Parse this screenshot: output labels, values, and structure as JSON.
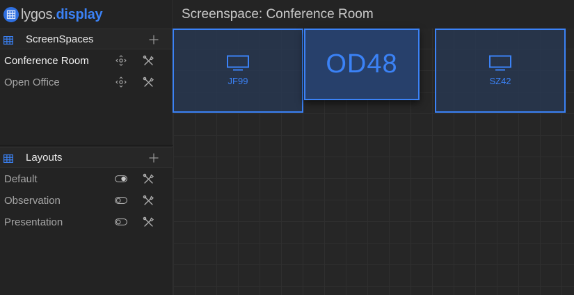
{
  "brand": {
    "name_part1": "lygos.",
    "name_part2": "display"
  },
  "sidebar": {
    "screenspaces": {
      "title": "ScreenSpaces",
      "items": [
        {
          "label": "Conference Room"
        },
        {
          "label": "Open Office"
        }
      ]
    },
    "layouts": {
      "title": "Layouts",
      "items": [
        {
          "label": "Default",
          "toggle_on": true
        },
        {
          "label": "Observation",
          "toggle_on": false
        },
        {
          "label": "Presentation",
          "toggle_on": false
        }
      ]
    }
  },
  "main": {
    "title": "Screenspace: Conference Room",
    "screens": [
      {
        "name": "JF99"
      },
      {
        "name": "OD48"
      },
      {
        "name": "SZ42"
      }
    ]
  },
  "colors": {
    "accent": "#3b82f6",
    "background": "#242424"
  },
  "icons": {
    "brand": "grid-logo-icon",
    "screenspaces": "grid-icon",
    "add": "plus-icon",
    "move": "move-icon",
    "tools": "tools-icon",
    "toggle": "toggle-icon",
    "monitor": "monitor-icon"
  }
}
